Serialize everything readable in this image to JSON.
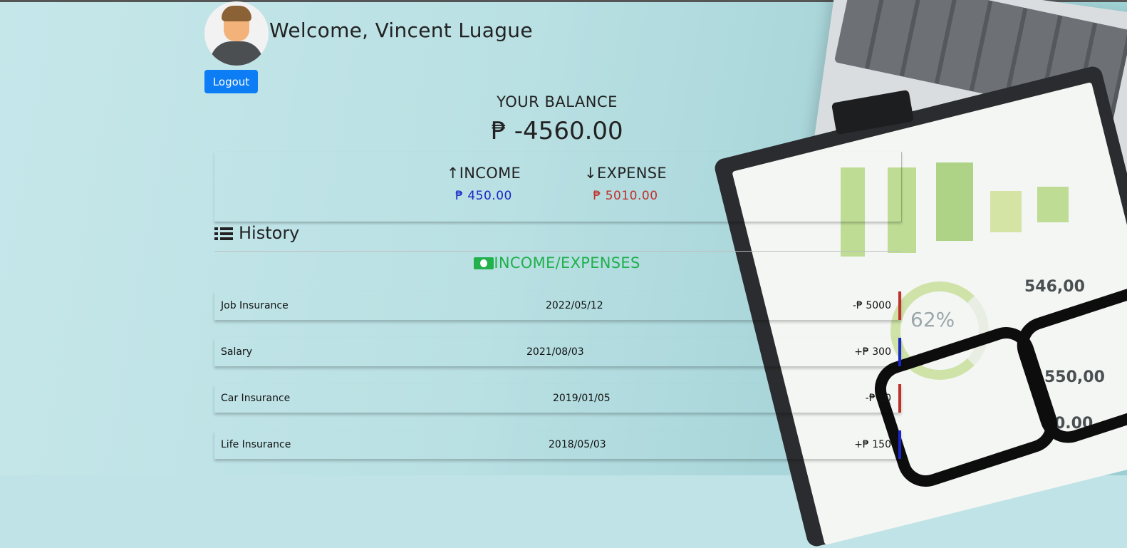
{
  "user": {
    "welcome": "Welcome, Vincent Luague",
    "logout_label": "Logout"
  },
  "balance": {
    "title": "YOUR BALANCE",
    "value": "₱ -4560.00"
  },
  "summary": {
    "income_label": "INCOME",
    "income_amount": "₱ 450.00",
    "expense_label": "EXPENSE",
    "expense_amount": "₱ 5010.00"
  },
  "history": {
    "title": "History",
    "section_heading": "INCOME/EXPENSES",
    "rows": [
      {
        "desc": "Job Insurance",
        "date": "2022/05/12",
        "amount": "-₱ 5000",
        "type": "expense"
      },
      {
        "desc": "Salary",
        "date": "2021/08/03",
        "amount": "+₱ 300",
        "type": "income"
      },
      {
        "desc": "Car Insurance",
        "date": "2019/01/05",
        "amount": "-₱ 10",
        "type": "expense"
      },
      {
        "desc": "Life Insurance",
        "date": "2018/05/03",
        "amount": "+₱ 150",
        "type": "income"
      }
    ]
  },
  "background": {
    "donut_label": "62%",
    "numbers": [
      "546,00",
      "550,00",
      "0.00"
    ]
  },
  "colors": {
    "primary": "#0d7df5",
    "income": "#1a27c8",
    "expense": "#c0312b",
    "accent_green": "#1fb04b"
  }
}
